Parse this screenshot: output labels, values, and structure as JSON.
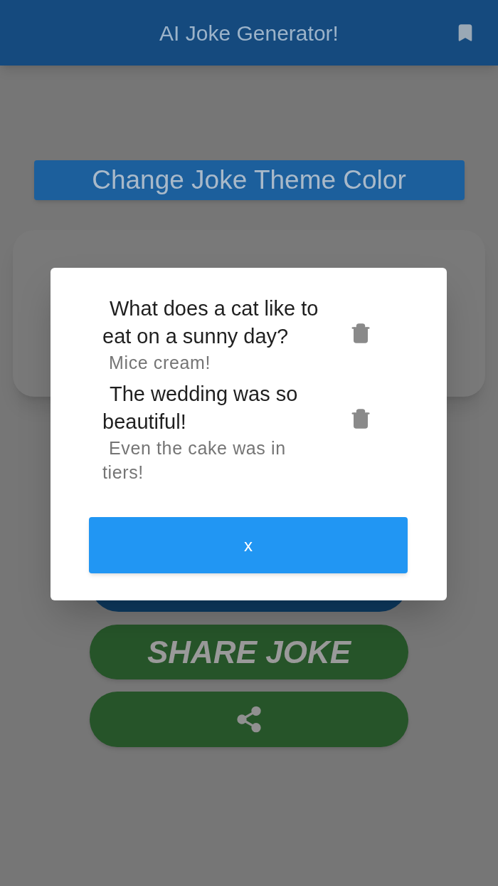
{
  "app_bar": {
    "title": "AI Joke Generator!"
  },
  "theme_button": {
    "label": "Change Joke Theme Color"
  },
  "share_button": {
    "label": "SHARE JOKE"
  },
  "dialog": {
    "jokes": [
      {
        "question": "What does a cat like to eat on a sunny day?",
        "answer": "Mice cream!"
      },
      {
        "question": "The wedding was so beautiful!",
        "answer": "Even the cake was in tiers!"
      }
    ],
    "close_label": "x"
  }
}
